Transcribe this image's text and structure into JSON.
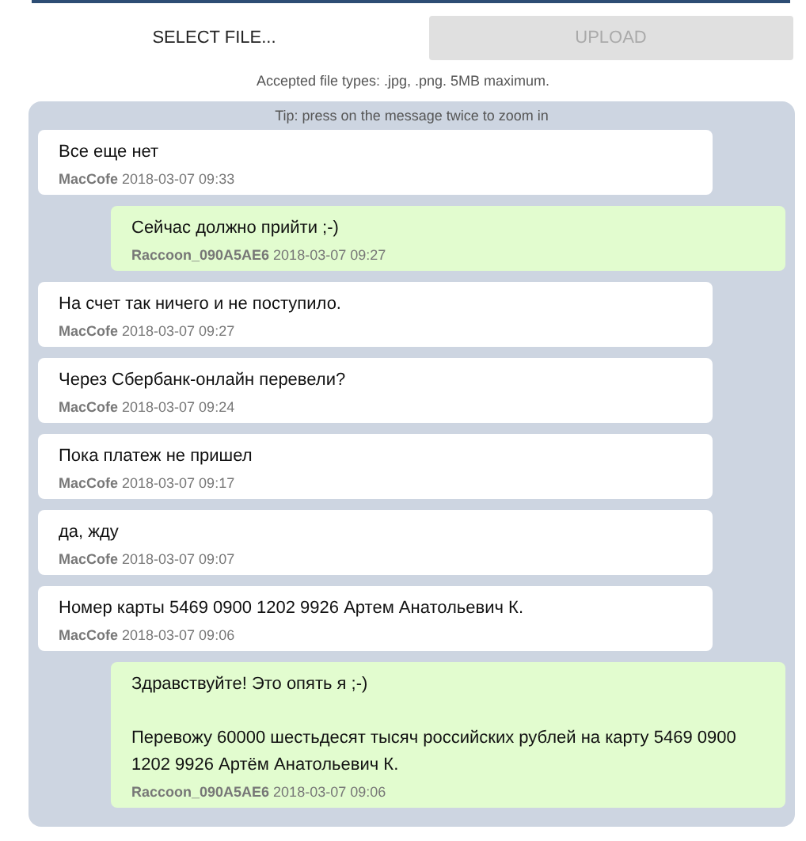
{
  "upload": {
    "select_button": "SELECT FILE...",
    "upload_button": {
      "label": "UPLOAD",
      "disabled": true
    },
    "hint": "Accepted file types: .jpg, .png. 5MB maximum."
  },
  "chat": {
    "tip": "Tip: press on the message twice to zoom in",
    "messages": [
      {
        "kind": "incoming",
        "text": "Все еще нет",
        "author": "MacCofe",
        "time": "2018-03-07 09:33"
      },
      {
        "kind": "outgoing",
        "text": "Сейчас должно прийти ;-)",
        "author": "Raccoon_090A5AE6",
        "time": "2018-03-07 09:27"
      },
      {
        "kind": "incoming",
        "text": "На счет так ничего и не поступило.",
        "author": "MacCofe",
        "time": "2018-03-07 09:27"
      },
      {
        "kind": "incoming",
        "text": "Через Сбербанк-онлайн перевели?",
        "author": "MacCofe",
        "time": "2018-03-07 09:24"
      },
      {
        "kind": "incoming",
        "text": "Пока платеж не пришел",
        "author": "MacCofe",
        "time": "2018-03-07 09:17"
      },
      {
        "kind": "incoming",
        "text": "да, жду",
        "author": "MacCofe",
        "time": "2018-03-07 09:07"
      },
      {
        "kind": "incoming",
        "text": "Номер карты 5469 0900 1202 9926 Артем Анатольевич К.",
        "author": "MacCofe",
        "time": "2018-03-07 09:06"
      },
      {
        "kind": "outgoing",
        "text": "Здравствуйте! Это опять я ;-)\n\nПеревожу 60000 шестьдесят тысяч российских рублей на карту 5469 0900 1202 9926 Артём Анатольевич К.",
        "author": "Raccoon_090A5AE6",
        "time": "2018-03-07 09:06"
      }
    ]
  }
}
